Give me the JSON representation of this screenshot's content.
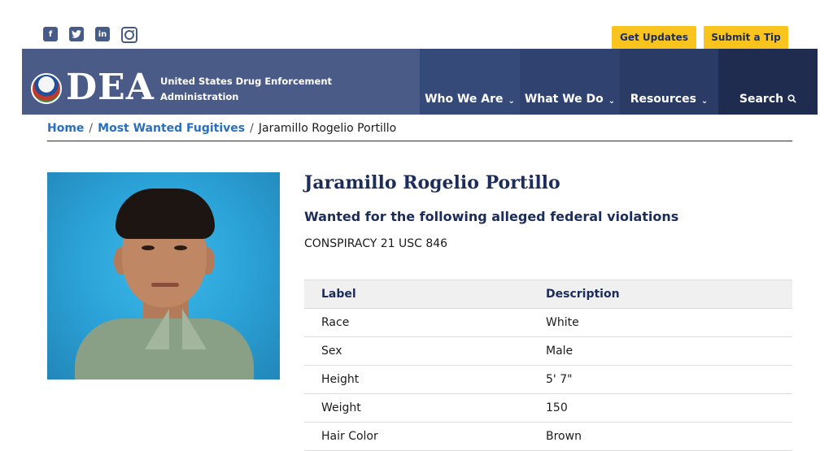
{
  "social": {
    "icons": [
      "facebook-icon",
      "twitter-icon",
      "linkedin-icon",
      "instagram-icon"
    ],
    "facebook_glyph": "f",
    "linkedin_glyph": "in"
  },
  "utility": {
    "get_updates": "Get Updates",
    "submit_tip": "Submit a Tip"
  },
  "header": {
    "logo": "DEA",
    "agency_line1": "United States Drug Enforcement",
    "agency_line2": "Administration"
  },
  "nav": {
    "who": "Who We Are",
    "what": "What We Do",
    "resources": "Resources",
    "search": "Search"
  },
  "breadcrumb": {
    "home": "Home",
    "section": "Most Wanted Fugitives",
    "current": "Jaramillo Rogelio Portillo",
    "separator": "/"
  },
  "profile": {
    "name": "Jaramillo Rogelio Portillo",
    "subhead": "Wanted for the following alleged federal violations",
    "violation": "CONSPIRACY 21 USC 846"
  },
  "table": {
    "headers": [
      "Label",
      "Description"
    ],
    "rows": [
      [
        "Race",
        "White"
      ],
      [
        "Sex",
        "Male"
      ],
      [
        "Height",
        "5' 7\""
      ],
      [
        "Weight",
        "150"
      ],
      [
        "Hair Color",
        "Brown"
      ]
    ]
  },
  "colors": {
    "header_bg": "#4a5b87",
    "accent_yellow": "#f8c41d",
    "link_blue": "#2a6fbf",
    "navy": "#1c2c5b"
  }
}
